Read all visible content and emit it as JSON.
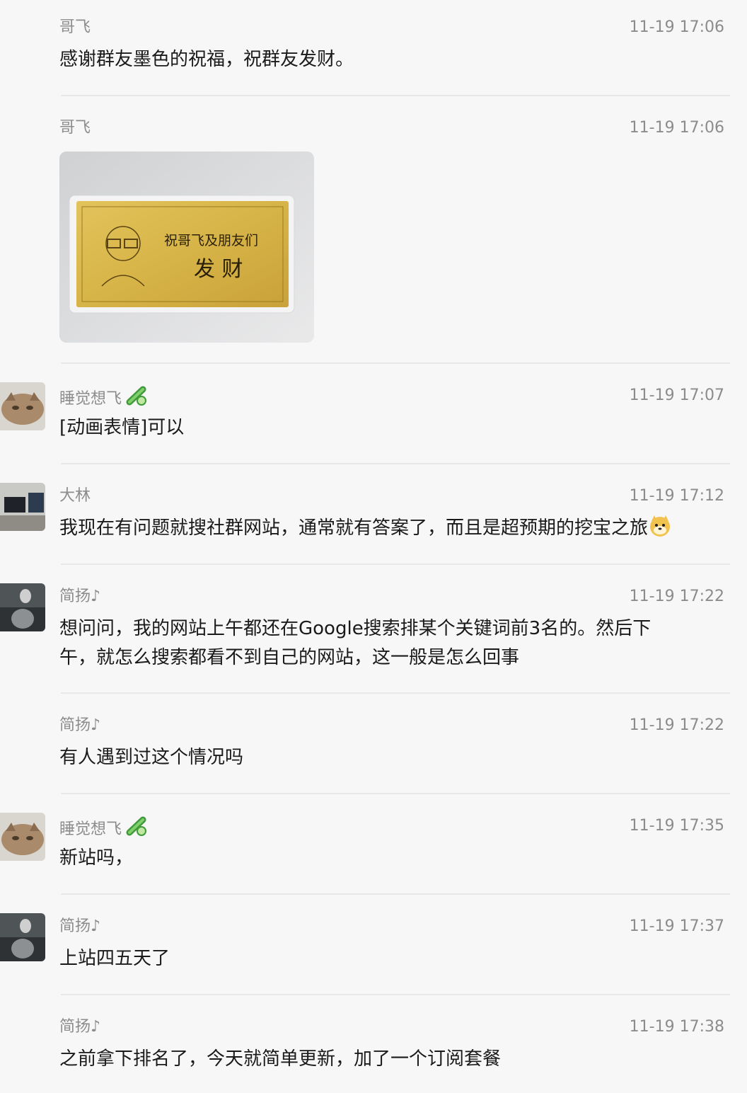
{
  "messages": [
    {
      "sender": "哥飞",
      "time": "11-19 17:06",
      "text": "感谢群友墨色的祝福，祝群友发财。"
    },
    {
      "sender": "哥飞",
      "time": "11-19 17:06",
      "image_text": {
        "line1": "祝哥飞及朋友们",
        "line2": "发 财"
      }
    },
    {
      "sender": "睡觉想飞",
      "time": "11-19 17:07",
      "text": "[动画表情]可以",
      "badge_icon": "cucumber-icon"
    },
    {
      "sender": "大林",
      "time": "11-19 17:12",
      "text": "我现在有问题就搜社群网站，通常就有答案了，而且是超预期的挖宝之旅",
      "trailing_icon": "doge-emoji-icon"
    },
    {
      "sender": "简扬♪",
      "time": "11-19 17:22",
      "text_line1": "想问问，我的网站上午都还在Google搜索排某个关键词前3名的。然后下",
      "text_line2": "午，就怎么搜索都看不到自己的网站，这一般是怎么回事"
    },
    {
      "sender": "简扬♪",
      "time": "11-19 17:22",
      "text": "有人遇到过这个情况吗"
    },
    {
      "sender": "睡觉想飞",
      "time": "11-19 17:35",
      "text": "新站吗，",
      "badge_icon": "cucumber-icon"
    },
    {
      "sender": "简扬♪",
      "time": "11-19 17:37",
      "text": "上站四五天了"
    },
    {
      "sender": "简扬♪",
      "time": "11-19 17:38",
      "text": "之前拿下排名了，今天就简单更新，加了一个订阅套餐"
    }
  ],
  "colors": {
    "background": "#f7f7f7",
    "meta_text": "#8c8c8c",
    "body_text": "#1a1a1a",
    "divider": "#e8e8e8",
    "gold_card": "#d9b84a"
  }
}
